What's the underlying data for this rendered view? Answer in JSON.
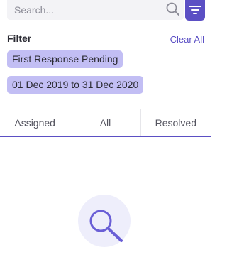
{
  "search": {
    "placeholder": "Search...",
    "icon": "search-icon"
  },
  "filter_button": {
    "icon": "filter-icon",
    "color": "#5b4fc4"
  },
  "filter": {
    "title": "Filter",
    "clear_label": "Clear All",
    "chips": [
      "First Response Pending",
      "01 Dec 2019 to 31 Dec 2020"
    ]
  },
  "tabs": [
    {
      "label": "Assigned"
    },
    {
      "label": "All"
    },
    {
      "label": "Resolved"
    }
  ],
  "empty_state": {
    "icon": "magnifier-icon"
  },
  "colors": {
    "accent": "#5b4fc4",
    "chip_background": "#c2bef4",
    "search_background": "#f3f3f6"
  }
}
